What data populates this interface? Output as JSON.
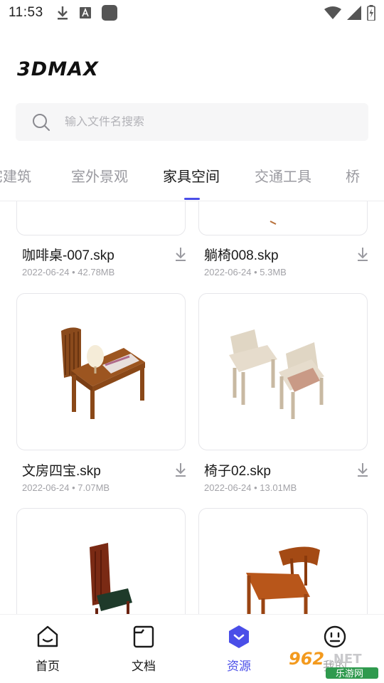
{
  "status_bar": {
    "time": "11:53"
  },
  "app": {
    "logo_text": "3DMAX"
  },
  "search": {
    "placeholder": "输入文件名搜索"
  },
  "tabs": [
    {
      "label": "住宅建筑"
    },
    {
      "label": "室外景观"
    },
    {
      "label": "家具空间"
    },
    {
      "label": "交通工具"
    },
    {
      "label": "桥"
    }
  ],
  "active_tab": "家具空间",
  "items": [
    {
      "title": "咖啡桌-007.skp",
      "date": "2022-06-24",
      "size": "42.78MB",
      "meta": "2022-06-24 • 42.78MB"
    },
    {
      "title": "躺椅008.skp",
      "date": "2022-06-24",
      "size": "5.3MB",
      "meta": "2022-06-24 • 5.3MB"
    },
    {
      "title": "文房四宝.skp",
      "date": "2022-06-24",
      "size": "7.07MB",
      "meta": "2022-06-24 • 7.07MB"
    },
    {
      "title": "椅子02.skp",
      "date": "2022-06-24",
      "size": "13.01MB",
      "meta": "2022-06-24 • 13.01MB"
    },
    {
      "title": "",
      "meta": ""
    },
    {
      "title": "",
      "meta": ""
    }
  ],
  "bottom_nav": [
    {
      "label": "首页",
      "icon": "home-icon"
    },
    {
      "label": "文档",
      "icon": "folder-icon"
    },
    {
      "label": "资源",
      "icon": "resource-icon"
    },
    {
      "label": "我的",
      "icon": "profile-icon"
    }
  ],
  "active_nav": "资源",
  "watermark": {
    "number": "962",
    "suffix": ".NET",
    "caption": "乐游网"
  },
  "colors": {
    "accent": "#4a4ee8",
    "watermark_orange": "#f39a1e",
    "watermark_green": "#2f9a4e"
  }
}
